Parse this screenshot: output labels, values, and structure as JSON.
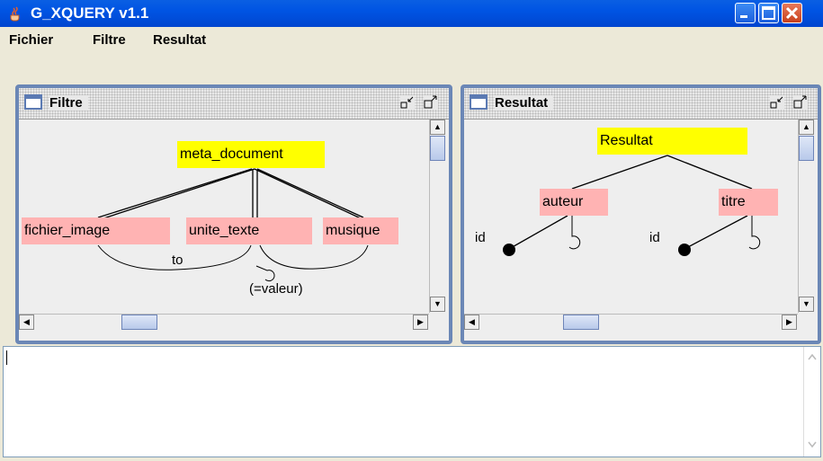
{
  "window": {
    "title": "G_XQUERY v1.1"
  },
  "menu": {
    "items": [
      "Fichier",
      "Filtre",
      "Resultat"
    ]
  },
  "filtre": {
    "title": "Filtre",
    "root": "meta_document",
    "children": [
      "fichier_image",
      "unite_texte",
      "musique"
    ],
    "join_label": "to",
    "value_label": "(=valeur)"
  },
  "resultat": {
    "title": "Resultat",
    "root": "Resultat",
    "children": [
      "auteur",
      "titre"
    ],
    "attr_labels": [
      "id",
      "id"
    ]
  },
  "editor": {
    "text": ""
  },
  "colors": {
    "root_node": "#ffff00",
    "child_node": "#ffb3b3",
    "frame_border": "#6b87b6"
  }
}
